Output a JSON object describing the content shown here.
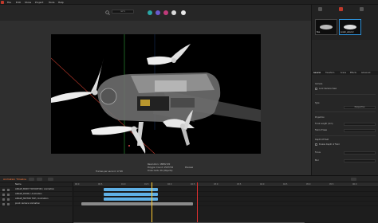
{
  "menu": {
    "items": [
      "File",
      "Edit",
      "Show",
      "Project",
      "Tools",
      "Help"
    ]
  },
  "toolbar": {
    "field_text": "ref 1"
  },
  "viewport": {
    "info_left": "Frames per second: 17.98",
    "info_center": [
      "Resolution: 1888x720",
      "Polygon Count: 1507729",
      "Draw Calls: 26 (Objects)"
    ],
    "info_right": "Preview"
  },
  "right_panel": {
    "thumbnails": [
      {
        "label": "Bee",
        "selected": false
      },
      {
        "label": "poster_exterior",
        "selected": true
      }
    ],
    "tabs": [
      "General",
      "Transform",
      "Scene",
      "Effects",
      "Advanced"
    ],
    "properties": {
      "section_1": "Camera",
      "lock_label": "Lock Camera View",
      "label_type": "Type",
      "value_type": "Perspective",
      "label_projection": "Projection",
      "label_focal": "Focal Length (mm)",
      "label_fov": "Field of View",
      "section_dof": "Depth Of Field",
      "label_enable_dof": "Enable Depth of Field",
      "label_focus": "Focus",
      "label_blur": "Blur"
    }
  },
  "timeline": {
    "title": "Animation  Timeline",
    "tracks_header": "Name",
    "tracks": [
      "ANGLE_BODY TOP ROTOR / Animation",
      "ANGLE_DOOR / Animation",
      "ANGLE_MOTOR TOP / Animation",
      "pivot camera Animation"
    ],
    "ruler_labels": [
      "00:0",
      "00:5",
      "01:0",
      "01:5",
      "02:0",
      "02:5",
      "03:0",
      "03:5",
      "04:0",
      "04:5",
      "05:0",
      "05:5",
      "06:0"
    ],
    "colors": {
      "clip": "#5fb0e6",
      "clip_alt": "#8a8a8a",
      "playhead": "#ffcc33",
      "end": "#e03030"
    }
  }
}
